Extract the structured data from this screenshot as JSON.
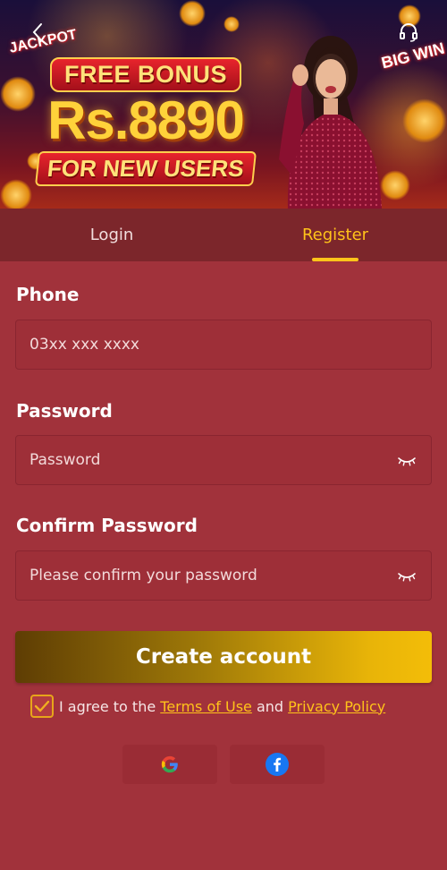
{
  "banner": {
    "jackpot_text": "JACKPOT",
    "big_win_text": "BIG WIN",
    "promo_line1": "FREE BONUS",
    "promo_line2": "Rs.8890",
    "promo_line3": "FOR NEW USERS"
  },
  "tabs": [
    {
      "label": "Login",
      "active": false
    },
    {
      "label": "Register",
      "active": true
    }
  ],
  "form": {
    "phone": {
      "label": "Phone",
      "placeholder": "03xx xxx xxxx",
      "value": ""
    },
    "password": {
      "label": "Password",
      "placeholder": "Password",
      "value": ""
    },
    "confirm_password": {
      "label": "Confirm Password",
      "placeholder": "Please confirm your password",
      "value": ""
    },
    "submit_label": "Create account"
  },
  "agreement": {
    "checked": true,
    "prefix": "I agree to the",
    "terms_link": "Terms of Use",
    "conjunction": "and",
    "privacy_link": "Privacy Policy"
  },
  "social_logins": [
    {
      "name": "google-icon"
    },
    {
      "name": "facebook-icon"
    }
  ],
  "icons": {
    "back": "chevron-left-icon",
    "support": "headset-icon",
    "eye": "eye-closed-icon",
    "check": "check-icon"
  },
  "colors": {
    "background": "#a1323b",
    "tab_bar": "#7c262b",
    "accent": "#ffc31a",
    "button_gradient_start": "#5e3d04",
    "button_gradient_end": "#f3bd08",
    "facebook": "#1877f2"
  }
}
